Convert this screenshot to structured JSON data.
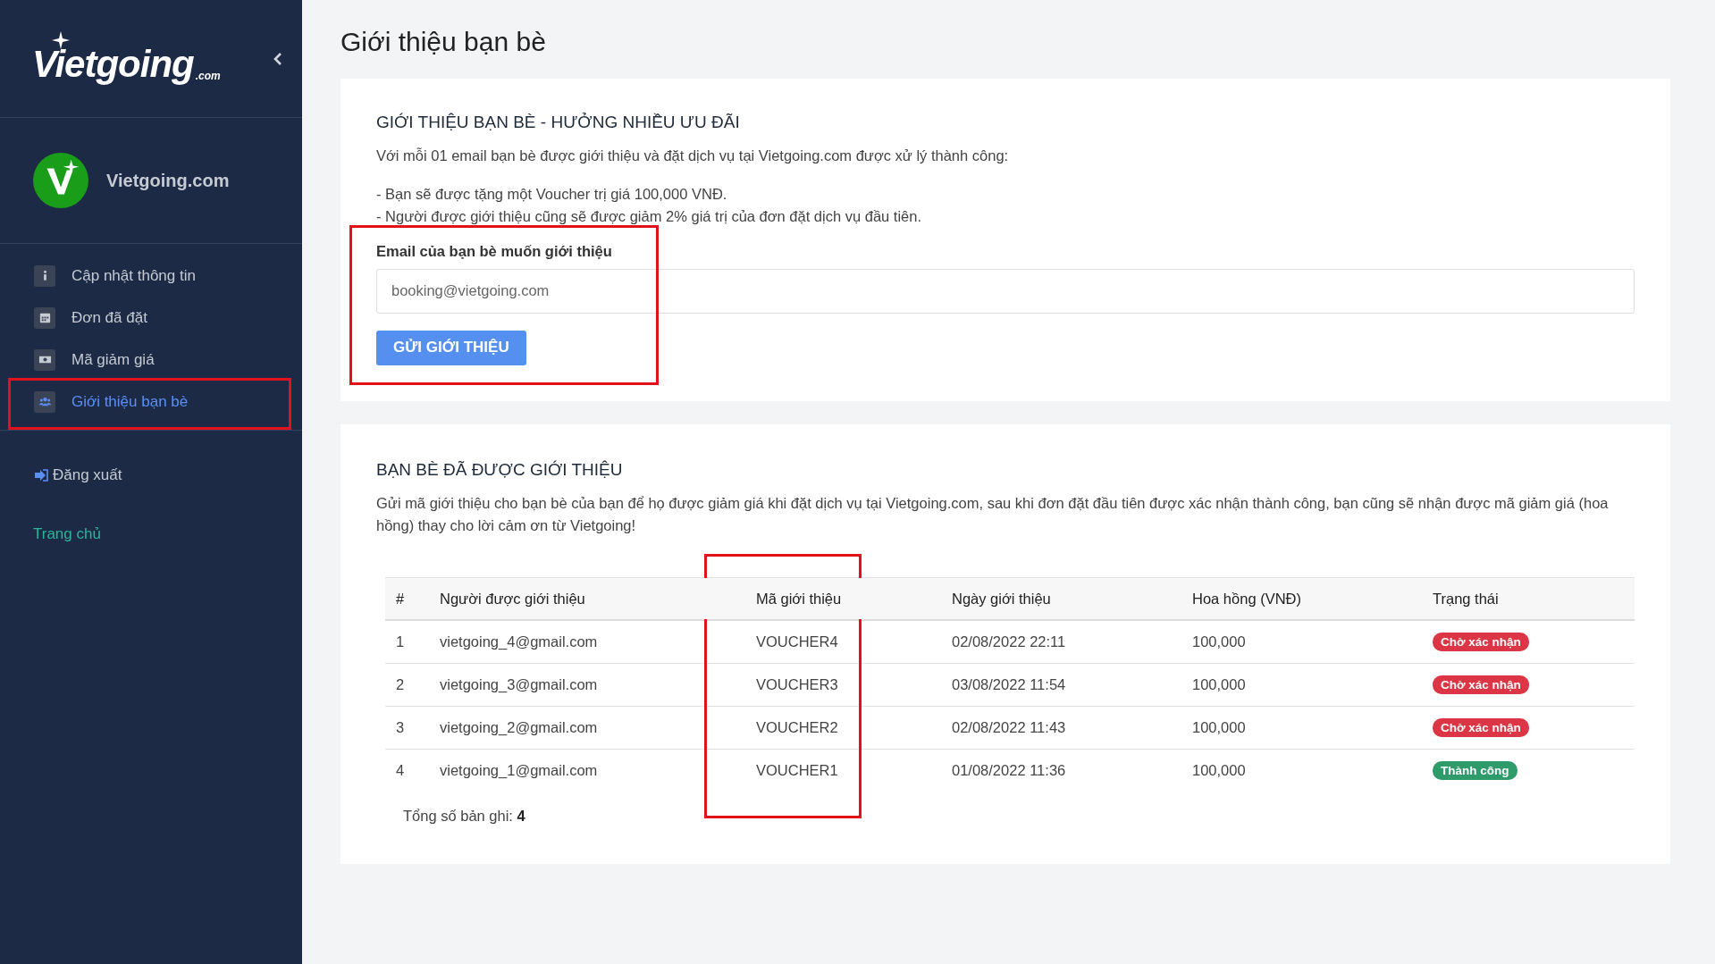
{
  "sidebar": {
    "logo": {
      "text": "Vietgoing",
      "sub": ".com"
    },
    "profile": {
      "name": "Vietgoing.com"
    },
    "items": [
      {
        "label": "Cập nhật thông tin",
        "kind": "info",
        "selected": false,
        "highlighted": false
      },
      {
        "label": "Đơn đã đặt",
        "kind": "calendar",
        "selected": false,
        "highlighted": false
      },
      {
        "label": "Mã giảm giá",
        "kind": "money",
        "selected": false,
        "highlighted": false
      },
      {
        "label": "Giới thiệu bạn bè",
        "kind": "users",
        "selected": true,
        "highlighted": true
      }
    ],
    "logout": "Đăng xuất",
    "home_link": "Trang chủ"
  },
  "page_title": "Giới thiệu bạn bè",
  "invite_card": {
    "heading": "GIỚI THIỆU BẠN BÈ - HƯỞNG NHIỀU ƯU ĐÃI",
    "intro": "Với mỗi 01 email bạn bè được giới thiệu và đặt dịch vụ tại Vietgoing.com được xử lý thành công:",
    "benefits": [
      "- Bạn sẽ được tặng một Voucher trị giá 100,000 VNĐ.",
      "- Người được giới thiệu cũng sẽ được giảm 2% giá trị của đơn đặt dịch vụ đầu tiên."
    ],
    "email_label": "Email của bạn bè muốn giới thiệu",
    "email_placeholder": "booking@vietgoing.com",
    "submit": "GỬI GIỚI THIỆU",
    "highlighted": true
  },
  "referrals_card": {
    "heading": "BẠN BÈ ĐÃ ĐƯỢC GIỚI THIỆU",
    "description": "Gửi mã giới thiệu cho bạn bè của bạn để họ được giảm giá khi đặt dịch vụ tại Vietgoing.com, sau khi đơn đặt đầu tiên được xác nhận thành công, bạn cũng sẽ nhận được mã giảm giá (hoa hồng) thay cho lời cảm ơn từ Vietgoing!",
    "table": {
      "columns": [
        {
          "label": "#",
          "highlighted": false
        },
        {
          "label": "Người được giới thiệu",
          "highlighted": false
        },
        {
          "label": "Mã giới thiệu",
          "highlighted": true
        },
        {
          "label": "Ngày giới thiệu",
          "highlighted": false
        },
        {
          "label": "Hoa hồng (VNĐ)",
          "highlighted": false
        },
        {
          "label": "Trạng thái",
          "highlighted": false
        }
      ],
      "rows": [
        {
          "cells": [
            "1",
            "vietgoing_4@gmail.com",
            "VOUCHER4",
            "02/08/2022 22:11",
            "100,000"
          ],
          "status": "Chờ xác nhận",
          "color": "#dc3545"
        },
        {
          "cells": [
            "2",
            "vietgoing_3@gmail.com",
            "VOUCHER3",
            "03/08/2022 11:54",
            "100,000"
          ],
          "status": "Chờ xác nhận",
          "color": "#dc3545"
        },
        {
          "cells": [
            "3",
            "vietgoing_2@gmail.com",
            "VOUCHER2",
            "02/08/2022 11:43",
            "100,000"
          ],
          "status": "Chờ xác nhận",
          "color": "#dc3545"
        },
        {
          "cells": [
            "4",
            "vietgoing_1@gmail.com",
            "VOUCHER1",
            "01/08/2022 11:36",
            "100,000"
          ],
          "status": "Thành công",
          "color": "#2f9a6a"
        }
      ]
    },
    "total_label": "Tổng số bản ghi:",
    "total_value": "4"
  }
}
